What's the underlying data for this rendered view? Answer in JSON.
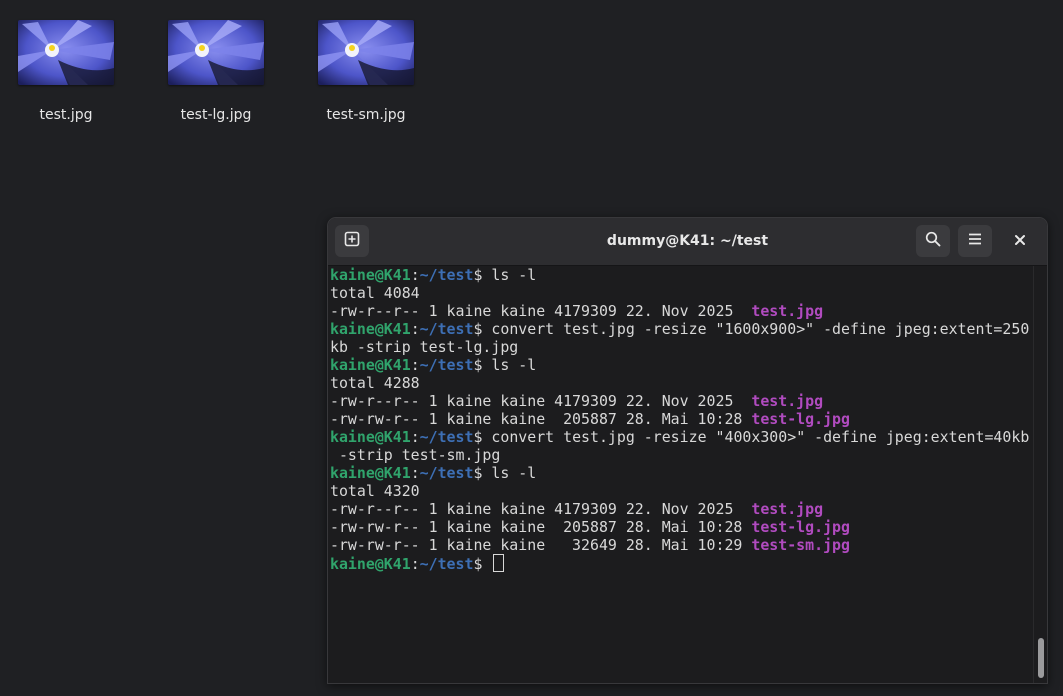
{
  "desktop": {
    "icons": [
      {
        "label": "test.jpg"
      },
      {
        "label": "test-lg.jpg"
      },
      {
        "label": "test-sm.jpg"
      }
    ]
  },
  "terminal": {
    "title": "dummy@K41: ~/test",
    "buttons": {
      "new_tab": "new-tab-icon",
      "search": "search-icon",
      "menu": "hamburger-menu-icon",
      "close": "close-icon"
    },
    "colors": {
      "prompt_user": "#30a46c",
      "prompt_path": "#3d6fb5",
      "file_highlight": "#b14bc0"
    },
    "prompt": {
      "user": "kaine@K41",
      "sep": ":",
      "path": "~/test",
      "sign": "$"
    },
    "lines": [
      {
        "type": "cmd",
        "text": " ls -l"
      },
      {
        "type": "out",
        "text": "total 4084"
      },
      {
        "type": "file",
        "text": "-rw-r--r-- 1 kaine kaine 4179309 22. Nov 2025  ",
        "file": "test.jpg"
      },
      {
        "type": "cmd",
        "text": " convert test.jpg -resize \"1600x900>\" -define jpeg:extent=250"
      },
      {
        "type": "out",
        "text": "kb -strip test-lg.jpg"
      },
      {
        "type": "cmd",
        "text": " ls -l"
      },
      {
        "type": "out",
        "text": "total 4288"
      },
      {
        "type": "file",
        "text": "-rw-r--r-- 1 kaine kaine 4179309 22. Nov 2025  ",
        "file": "test.jpg"
      },
      {
        "type": "file",
        "text": "-rw-rw-r-- 1 kaine kaine  205887 28. Mai 10:28 ",
        "file": "test-lg.jpg"
      },
      {
        "type": "cmd",
        "text": " convert test.jpg -resize \"400x300>\" -define jpeg:extent=40kb"
      },
      {
        "type": "out",
        "text": " -strip test-sm.jpg"
      },
      {
        "type": "cmd",
        "text": " ls -l"
      },
      {
        "type": "out",
        "text": "total 4320"
      },
      {
        "type": "file",
        "text": "-rw-r--r-- 1 kaine kaine 4179309 22. Nov 2025  ",
        "file": "test.jpg"
      },
      {
        "type": "file",
        "text": "-rw-rw-r-- 1 kaine kaine  205887 28. Mai 10:28 ",
        "file": "test-lg.jpg"
      },
      {
        "type": "file",
        "text": "-rw-rw-r-- 1 kaine kaine   32649 28. Mai 10:29 ",
        "file": "test-sm.jpg"
      },
      {
        "type": "prompt",
        "text": " "
      }
    ]
  }
}
